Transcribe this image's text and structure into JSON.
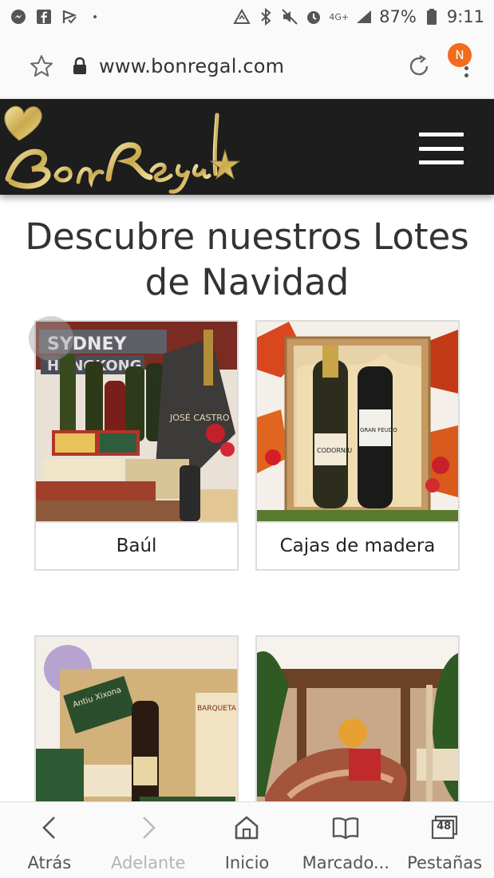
{
  "status_bar": {
    "battery": "87%",
    "time": "9:11",
    "network": "4G+"
  },
  "browser": {
    "url": "www.bonregal.com",
    "notification_badge": "N",
    "accent": "#f26c1c"
  },
  "site": {
    "logo_text": "BonRegal",
    "header_bg": "#1d1d1d"
  },
  "main": {
    "headline": "Descubre nuestros Lotes de Navidad",
    "products": [
      {
        "label": "Baúl",
        "image_labels": [
          "SYDNEY",
          "HONGKONG",
          "JOSÉ CASTRO"
        ]
      },
      {
        "label": "Cajas de madera",
        "image_labels": [
          "CODORNIU",
          "GRAN FEUDO"
        ]
      },
      {
        "label": "",
        "image_labels": [
          "Antiu Xixona",
          "BARQUETA"
        ]
      },
      {
        "label": "",
        "image_labels": []
      }
    ]
  },
  "bottom_bar": {
    "items": [
      {
        "label": "Atrás",
        "icon": "chevron-left-icon"
      },
      {
        "label": "Adelante",
        "icon": "chevron-right-icon"
      },
      {
        "label": "Inicio",
        "icon": "home-icon"
      },
      {
        "label": "Marcado...",
        "icon": "bookmarks-icon"
      },
      {
        "label": "Pestañas",
        "icon": "tabs-icon",
        "count": "48"
      }
    ]
  }
}
